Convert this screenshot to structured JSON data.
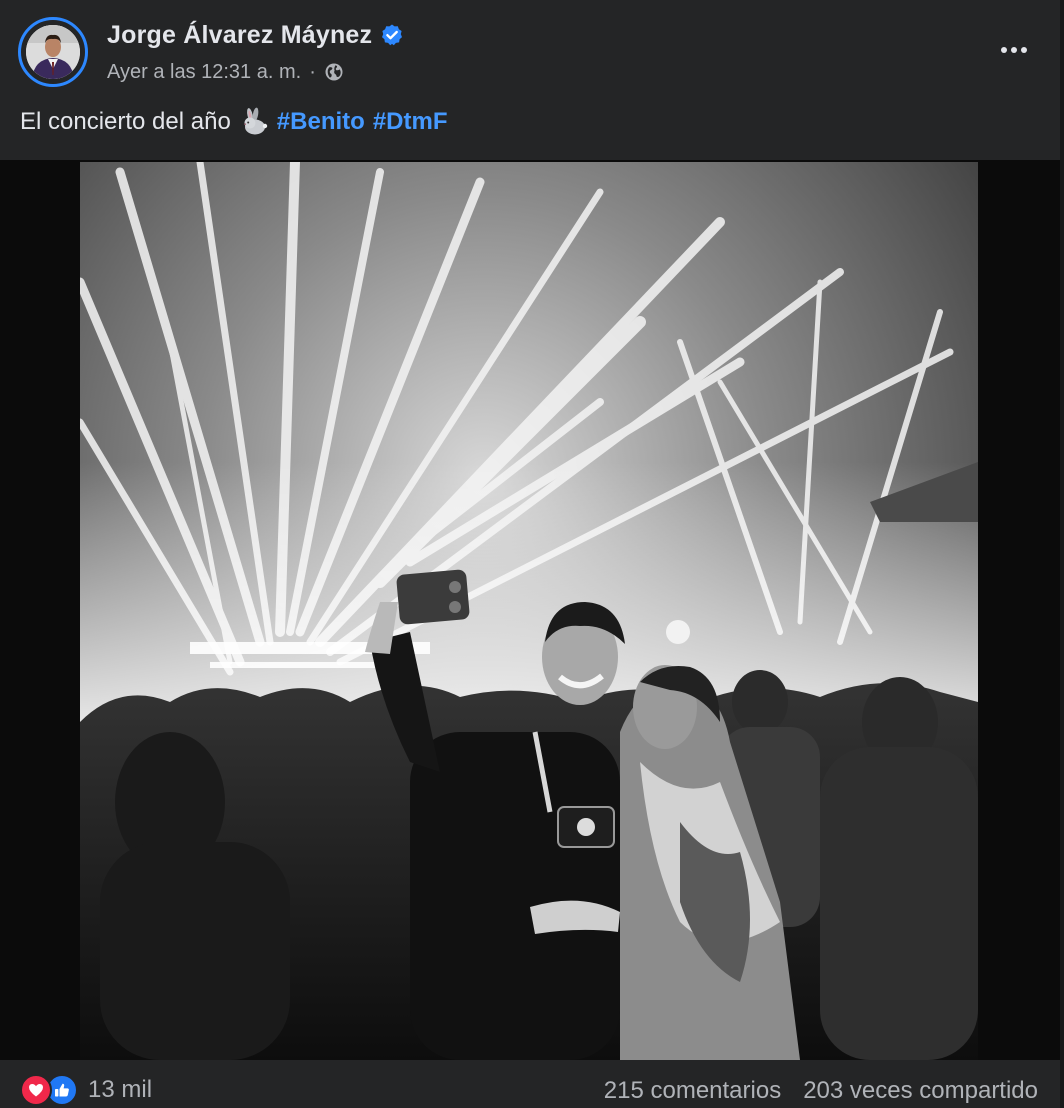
{
  "post": {
    "author": {
      "name": "Jorge Álvarez Máynez",
      "avatar_icon": "profile-avatar",
      "verified_icon": "verified-badge-icon"
    },
    "meta": {
      "timestamp": "Ayer a las 12:31 a. m.",
      "separator": "·",
      "privacy_icon": "globe-icon"
    },
    "caption": {
      "text": "El concierto del año",
      "emoji_icon": "rabbit-icon",
      "hashtags": [
        "#Benito",
        "#DtmF"
      ]
    },
    "media": {
      "type": "photo",
      "style": "black-and-white concert crowd selfie with laser lights"
    },
    "footer": {
      "reaction_icons": [
        "love-reaction-icon",
        "like-reaction-icon"
      ],
      "reaction_count": "13 mil",
      "comments": "215 comentarios",
      "shares": "203 veces compartido"
    }
  },
  "colors": {
    "background": "#242526",
    "primary_text": "#e4e6eb",
    "secondary_text": "#b0b3b8",
    "link": "#4599ff",
    "verified": "#2d88ff",
    "love": "#f0284a",
    "like": "#2078f4"
  }
}
